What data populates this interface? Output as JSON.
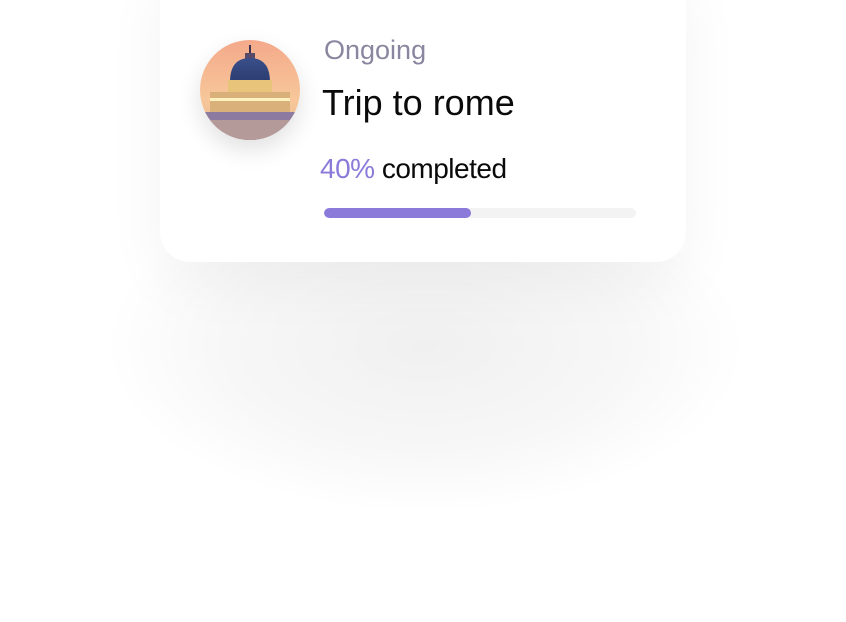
{
  "trip": {
    "status": "Ongoing",
    "title": "Trip to rome",
    "percent_label": "40%",
    "completed_label": "completed",
    "progress_bar_fill_percent": 47,
    "avatar_icon": "st-peters-basilica-photo",
    "accent_color": "#8b7ad9"
  }
}
